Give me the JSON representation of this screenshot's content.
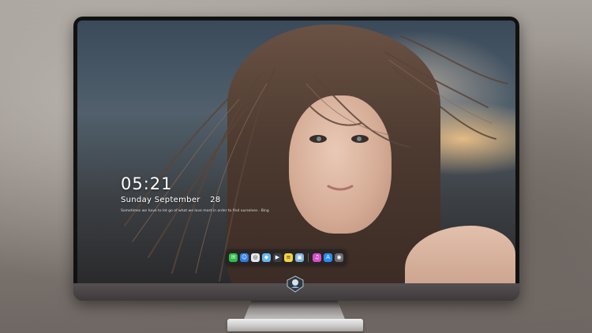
{
  "lock_screen": {
    "time": "05:21",
    "weekday": "Sunday",
    "month": "September",
    "day": "28",
    "quote": "Sometimes we have to let go of what we love most in order to find ourselves  ·  Bing"
  },
  "dock": {
    "items": [
      {
        "name": "messages",
        "glyph": "✉",
        "color": "#2fbf4a"
      },
      {
        "name": "finder",
        "glyph": "☺",
        "color": "#2e7ee6"
      },
      {
        "name": "safari",
        "glyph": "◎",
        "color": "#e8e8ec"
      },
      {
        "name": "maps",
        "glyph": "◆",
        "color": "#67b7f0"
      },
      {
        "name": "video-editor",
        "glyph": "▶",
        "color": "#3c3c48"
      },
      {
        "name": "notes",
        "glyph": "≡",
        "color": "#f5d342"
      },
      {
        "name": "preview",
        "glyph": "▣",
        "color": "#7fb3d9"
      },
      {
        "name": "itunes",
        "glyph": "♫",
        "color": "#d64fc8"
      },
      {
        "name": "app-store",
        "glyph": "A",
        "color": "#2a8df0"
      },
      {
        "name": "camera",
        "glyph": "◉",
        "color": "#6b6b70"
      }
    ]
  },
  "colors": {
    "dock_background": "#1e1e22",
    "bezel": "#111111",
    "chin": "#4a4546",
    "lock_text": "#ffffff"
  }
}
